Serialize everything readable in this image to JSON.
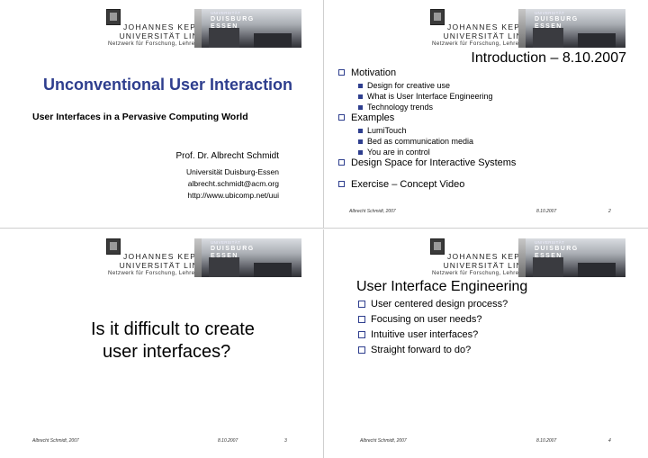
{
  "header": {
    "jku_name": "JOHANNES KEPLER",
    "jku_uni": "UNIVERSITÄT LINZ",
    "jku_tagline": "Netzwerk für Forschung, Lehre und Praxis",
    "ude_small": "UNIVERSITÄT",
    "ude_line1": "DUISBURG",
    "ude_line2": "ESSEN"
  },
  "slide1": {
    "title": "Unconventional User Interaction",
    "subtitle": "User Interfaces in a Pervasive Computing World",
    "author": "Prof. Dr. Albrecht Schmidt",
    "affiliation": "Universität Duisburg-Essen",
    "email": "albrecht.schmidt@acm.org",
    "url": "http://www.ubicomp.net/uui"
  },
  "slide2": {
    "title": "Introduction – 8.10.2007",
    "items": [
      {
        "level": 1,
        "text": "Motivation"
      },
      {
        "level": 2,
        "text": "Design for creative use"
      },
      {
        "level": 2,
        "text": "What is User Interface Engineering"
      },
      {
        "level": 2,
        "text": "Technology trends"
      },
      {
        "level": 1,
        "text": "Examples"
      },
      {
        "level": 2,
        "text": "LumiTouch"
      },
      {
        "level": 2,
        "text": "Bed as communication media"
      },
      {
        "level": 2,
        "text": "You are in control"
      },
      {
        "level": 1,
        "text": "Design Space for Interactive Systems"
      },
      {
        "level": 1,
        "text": "Exercise – Concept Video"
      }
    ],
    "footer_author": "Albrecht Schmidt, 2007",
    "footer_date": "8.10.2007",
    "page": "2"
  },
  "slide3": {
    "line1": "Is it difficult to create",
    "line2": "user interfaces?",
    "footer_author": "Albrecht Schmidt, 2007",
    "footer_date": "8.10.2007",
    "page": "3"
  },
  "slide4": {
    "title": "User Interface Engineering",
    "items": [
      "User centered design process?",
      "Focusing on user needs?",
      "Intuitive user interfaces?",
      "Straight forward to do?"
    ],
    "footer_author": "Albrecht Schmidt, 2007",
    "footer_date": "8.10.2007",
    "page": "4"
  }
}
